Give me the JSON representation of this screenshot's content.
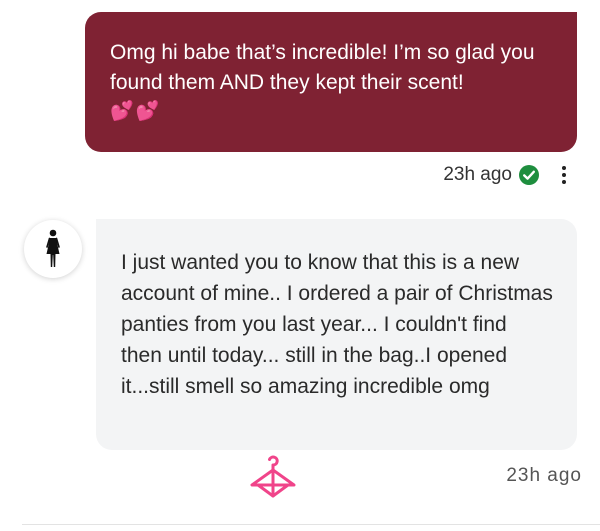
{
  "sent_message": {
    "text": "Omg hi babe that’s incredible! I’m so glad you found them AND they kept their scent!",
    "emoji": "💕💕",
    "timestamp": "23h ago",
    "status_icon": "check-circle-icon",
    "menu_icon": "more-vertical-icon",
    "bubble_color": "#7f2233"
  },
  "received_message": {
    "text": "I just wanted you to know that this is a new account of mine.. I ordered a pair of Christmas panties from you last year... I couldn't find then until today... still in the bag..I opened it...still smell so amazing incredible omg",
    "timestamp": "23h ago",
    "avatar_icon": "woman-figure-icon",
    "brand_icon": "hanger-icon",
    "bubble_color": "#f3f4f5"
  },
  "colors": {
    "accent_pink": "#f0448a",
    "check_green": "#1e8e3e"
  }
}
